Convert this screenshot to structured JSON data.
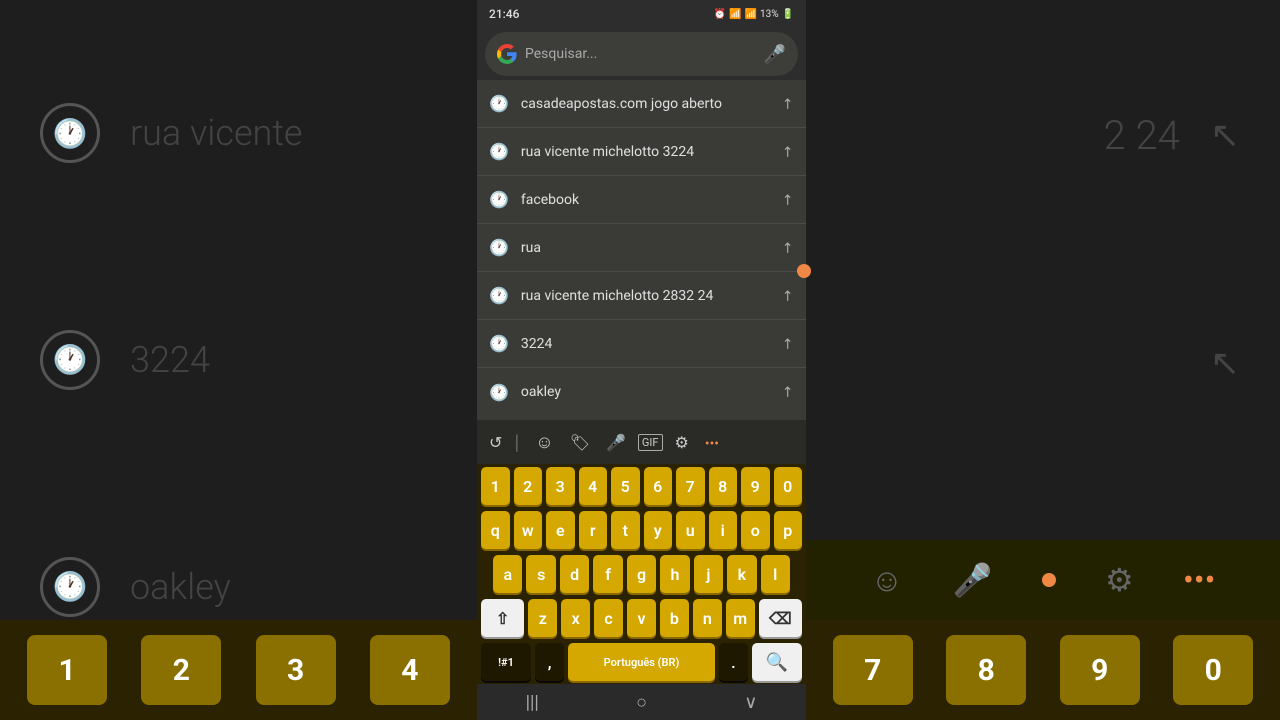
{
  "status_bar": {
    "time": "21:46",
    "battery": "13%"
  },
  "search": {
    "placeholder": "Pesquisar..."
  },
  "suggestions": [
    {
      "text": "casadeapostas.com jogo aberto"
    },
    {
      "text": "rua vicente michelotto 3224"
    },
    {
      "text": "facebook"
    },
    {
      "text": "rua"
    },
    {
      "text": "rua vicente michelotto 2832 24"
    },
    {
      "text": "3224"
    },
    {
      "text": "oakley"
    }
  ],
  "bg_left": {
    "items": [
      {
        "text": "rua vicente"
      },
      {
        "text": "3224"
      },
      {
        "text": "oakley"
      }
    ]
  },
  "bg_right": {
    "items": [
      {
        "text": "2 24"
      },
      {
        "text": ""
      },
      {
        "text": ""
      }
    ]
  },
  "keyboard": {
    "rows": [
      [
        "1",
        "2",
        "3",
        "4",
        "5",
        "6",
        "7",
        "8",
        "9",
        "0"
      ],
      [
        "q",
        "w",
        "e",
        "r",
        "t",
        "y",
        "u",
        "i",
        "o",
        "p"
      ],
      [
        "a",
        "s",
        "d",
        "f",
        "g",
        "h",
        "j",
        "k",
        "l"
      ],
      [
        "z",
        "x",
        "c",
        "v",
        "b",
        "n",
        "m"
      ]
    ],
    "special": {
      "shift": "⇧",
      "backspace": "⌫",
      "numbers": "!#1",
      "comma": ",",
      "space": "Português (BR)",
      "period": ".",
      "search": "🔍"
    }
  },
  "nav": {
    "menu": "|||",
    "home": "○",
    "back": "∨"
  },
  "bg_keyboard_numbers": [
    "1",
    "2",
    "3",
    "4",
    "7",
    "8",
    "9",
    "0"
  ]
}
